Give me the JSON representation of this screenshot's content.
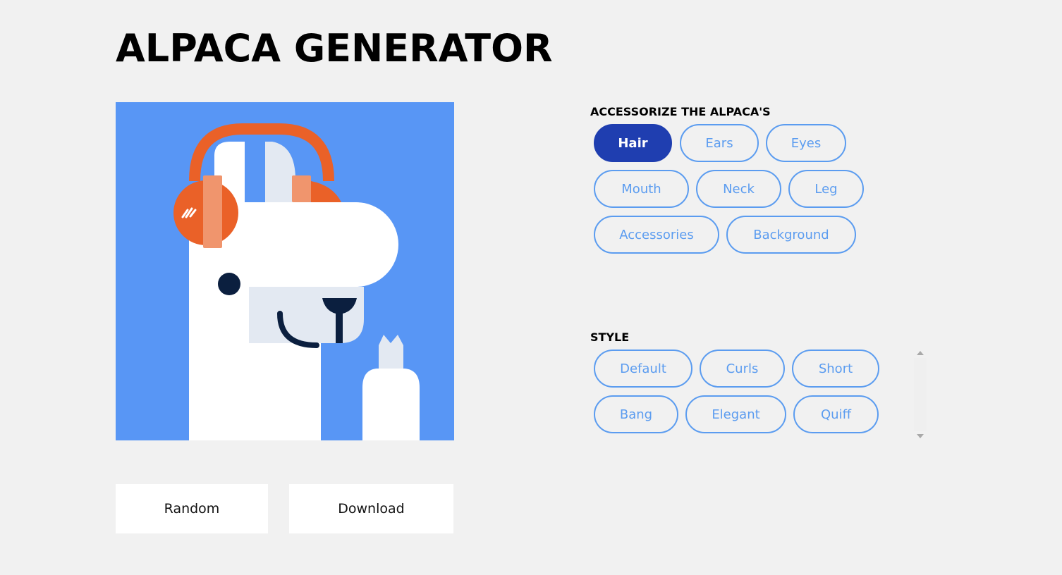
{
  "app": {
    "title": "ALPACA GENERATOR"
  },
  "actions": {
    "random_label": "Random",
    "download_label": "Download"
  },
  "accessorize": {
    "heading": "ACCESSORIZE THE ALPACA'S",
    "selected": "Hair",
    "items": [
      "Hair",
      "Ears",
      "Eyes",
      "Mouth",
      "Neck",
      "Leg",
      "Accessories",
      "Background"
    ]
  },
  "style": {
    "heading": "STYLE",
    "items": [
      "Default",
      "Curls",
      "Short",
      "Bang",
      "Elegant",
      "Quiff"
    ]
  },
  "colors": {
    "page_background": "#f1f1f1",
    "alpaca_background": "#5896f5",
    "headphones": "#ea6128",
    "headphone_pads": "#f0956d",
    "alpaca_body": "#ffffff",
    "muzzle": "#e3e9f2",
    "eye_and_nose": "#0b1f3f",
    "pill_active_fill": "#1f3eb0",
    "pill_outline": "#5b9cf0"
  }
}
